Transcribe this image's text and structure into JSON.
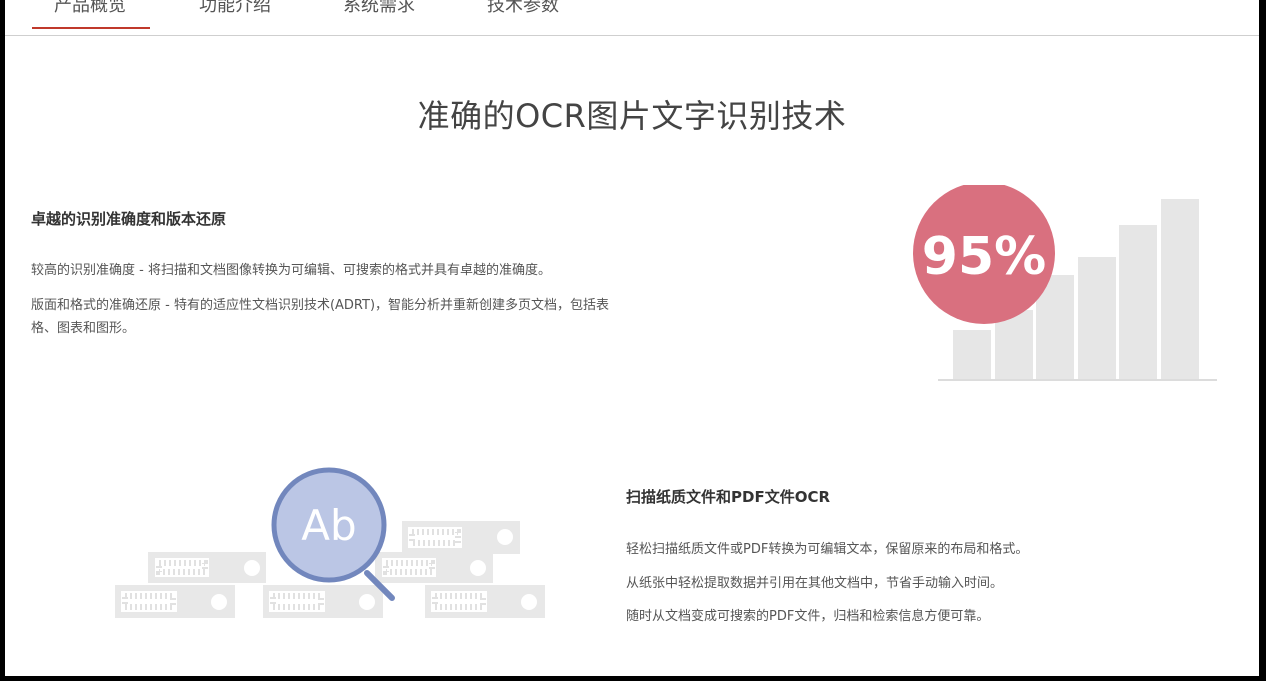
{
  "tabs": [
    {
      "label": "产品概览"
    },
    {
      "label": "功能介绍"
    },
    {
      "label": "系统需求"
    },
    {
      "label": "技术参数"
    }
  ],
  "main": {
    "title": "准确的OCR图片文字识别技术",
    "section1": {
      "heading": "卓越的识别准确度和版本还原",
      "p1": "较高的识别准确度 - 将扫描和文档图像转换为可编辑、可搜索的格式并具有卓越的准确度。",
      "p2": "版面和格式的准确还原 - 特有的适应性文档识别技术(ADRT)，智能分析并重新创建多页文档，包括表格、图表和图形。",
      "badge": "95%"
    },
    "section2": {
      "heading": "扫描纸质文件和PDF文件OCR",
      "p1": "轻松扫描纸质文件或PDF转换为可编辑文本，保留原来的布局和格式。",
      "p2": "从纸张中轻松提取数据并引用在其他文档中，节省手动输入时间。",
      "p3": "随时从文档变成可搜索的PDF文件，归档和检索信息方便可靠。",
      "magnifier_text": "Ab"
    }
  },
  "colors": {
    "accent": "#c0392b",
    "badge": "#d9707f",
    "magnifier": "#7287bd",
    "bars": "#e6e6e6"
  }
}
